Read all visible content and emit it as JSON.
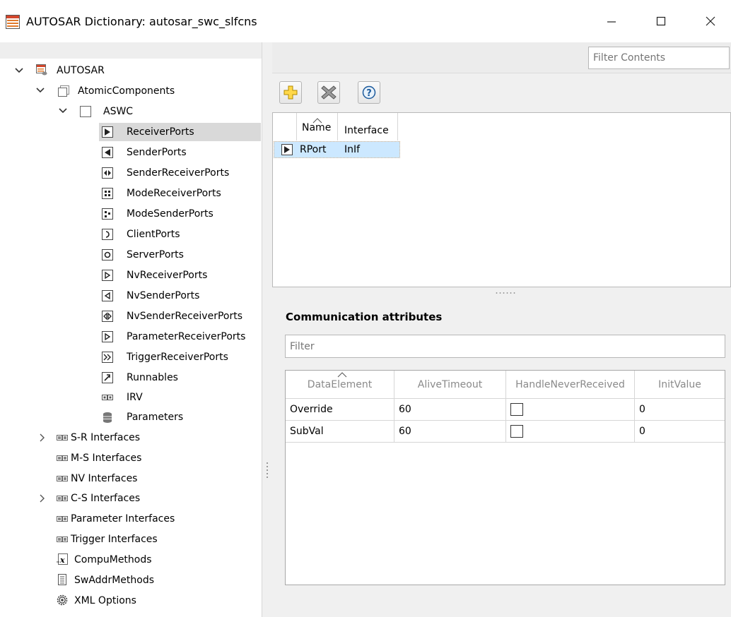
{
  "window": {
    "title": "AUTOSAR Dictionary: autosar_swc_slfcns",
    "minimize_glyph": "—",
    "maximize_glyph": "☐",
    "close_glyph": "✕"
  },
  "right_filter": {
    "placeholder": "Filter Contents"
  },
  "toolbar": {
    "add_icon": "add-icon",
    "delete_icon": "delete-icon",
    "help_icon": "help-icon",
    "help_glyph": "?"
  },
  "tree": {
    "root": "AUTOSAR",
    "atomic": "AtomicComponents",
    "aswc": "ASWC",
    "ports": [
      {
        "label": "ReceiverPorts",
        "icon": "receiver-port-icon"
      },
      {
        "label": "SenderPorts",
        "icon": "sender-port-icon"
      },
      {
        "label": "SenderReceiverPorts",
        "icon": "sender-receiver-port-icon"
      },
      {
        "label": "ModeReceiverPorts",
        "icon": "mode-receiver-port-icon"
      },
      {
        "label": "ModeSenderPorts",
        "icon": "mode-sender-port-icon"
      },
      {
        "label": "ClientPorts",
        "icon": "client-port-icon"
      },
      {
        "label": "ServerPorts",
        "icon": "server-port-icon"
      },
      {
        "label": "NvReceiverPorts",
        "icon": "nv-receiver-port-icon"
      },
      {
        "label": "NvSenderPorts",
        "icon": "nv-sender-port-icon"
      },
      {
        "label": "NvSenderReceiverPorts",
        "icon": "nv-sender-receiver-port-icon"
      },
      {
        "label": "ParameterReceiverPorts",
        "icon": "parameter-receiver-port-icon"
      },
      {
        "label": "TriggerReceiverPorts",
        "icon": "trigger-receiver-port-icon"
      },
      {
        "label": "Runnables",
        "icon": "runnable-icon"
      },
      {
        "label": "IRV",
        "icon": "irv-icon"
      },
      {
        "label": "Parameters",
        "icon": "parameters-icon"
      }
    ],
    "interfaces": [
      {
        "label": "S-R Interfaces",
        "expandable": true
      },
      {
        "label": "M-S Interfaces",
        "expandable": false
      },
      {
        "label": "NV Interfaces",
        "expandable": false
      },
      {
        "label": "C-S Interfaces",
        "expandable": true
      },
      {
        "label": "Parameter Interfaces",
        "expandable": false
      },
      {
        "label": "Trigger Interfaces",
        "expandable": false
      }
    ],
    "compu": "CompuMethods",
    "swaddr": "SwAddrMethods",
    "xml": "XML Options"
  },
  "ports_table": {
    "columns": [
      "Name",
      "Interface"
    ],
    "rows": [
      {
        "name": "RPort",
        "interface": "InIf"
      }
    ]
  },
  "comm": {
    "title": "Communication attributes",
    "filter_placeholder": "Filter",
    "columns": [
      "DataElement",
      "AliveTimeout",
      "HandleNeverReceived",
      "InitValue"
    ],
    "rows": [
      {
        "element": "Override",
        "alive": "60",
        "handle": false,
        "init": "0"
      },
      {
        "element": "SubVal",
        "alive": "60",
        "handle": false,
        "init": "0"
      }
    ]
  },
  "colors": {
    "selection_row": "#d9d9d9",
    "table_selection": "#cce8ff",
    "window_bg": "#f0f0f0"
  }
}
